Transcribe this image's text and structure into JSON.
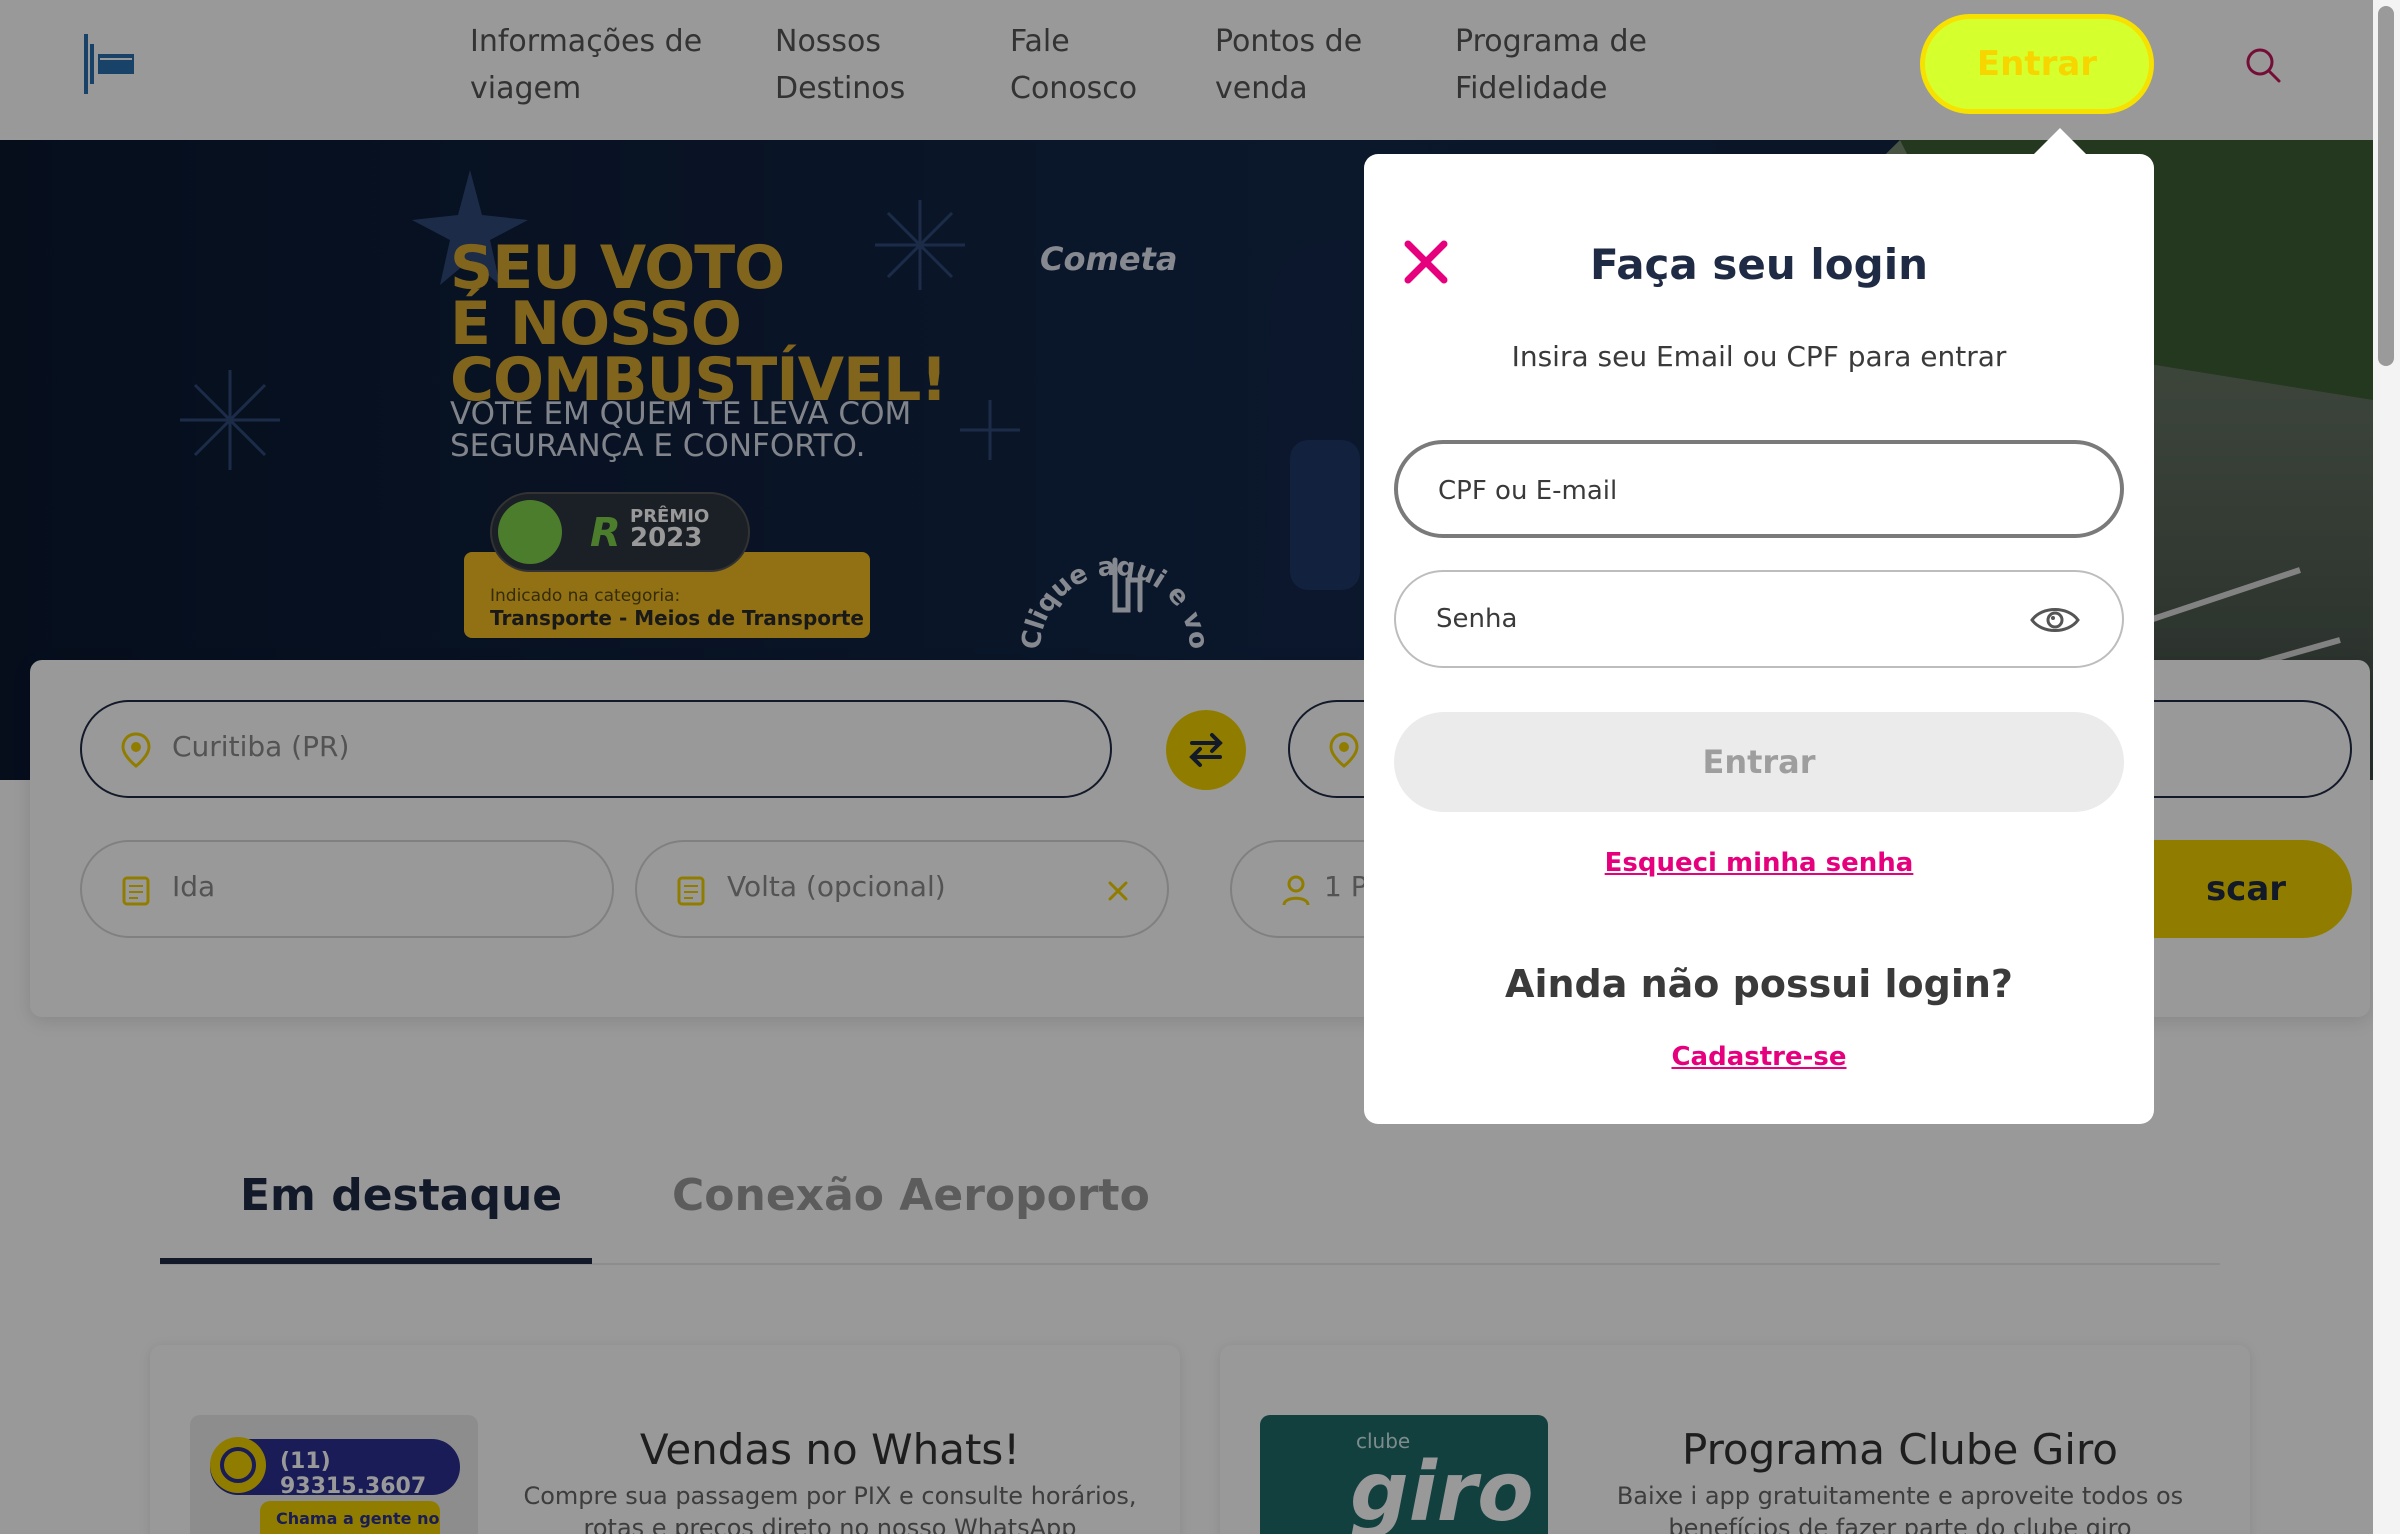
{
  "header": {
    "logo_alt": "Cometa logo",
    "nav": [
      {
        "line1": "Informações de",
        "line2": "viagem"
      },
      {
        "line1": "Nossos",
        "line2": "Destinos"
      },
      {
        "line1": "Fale",
        "line2": "Conosco"
      },
      {
        "line1": "Pontos de",
        "line2": "venda"
      },
      {
        "line1": "Programa de",
        "line2": "Fidelidade"
      }
    ],
    "login_button": "Entrar",
    "search_icon": "search-icon"
  },
  "banner": {
    "headline": [
      "SEU VOTO",
      "É NOSSO",
      "COMBUSTÍVEL!"
    ],
    "subline": [
      "VOTE EM QUEM TE LEVA COM",
      "SEGURANÇA E CONFORTO."
    ],
    "brand": "Cometa",
    "award": {
      "badge_letter": "R",
      "label_top": "PRÊMIO",
      "label_year": "2023",
      "category_intro": "Indicado na categoria:",
      "category": "Transporte - Meios de Transporte"
    },
    "cta_curved": "Clique aqui e vote"
  },
  "search": {
    "origin_value": "Curitiba (PR)",
    "dest_value": "",
    "ida_placeholder": "Ida",
    "volta_placeholder": "Volta (opcional)",
    "passengers_partial": "1 P",
    "buscar_partial": "scar"
  },
  "tabs": [
    {
      "label": "Em destaque",
      "active": true
    },
    {
      "label": "Conexão Aeroporto",
      "active": false
    }
  ],
  "promos": [
    {
      "title": "Vendas no Whats!",
      "desc_line1": "Compre sua passagem por PIX e consulte horários,",
      "desc_line2": "rotas e preços direto no nosso WhatsApp",
      "image_phone": "(11) 93315.3607",
      "image_caption": "Chama a gente no"
    },
    {
      "title": "Programa Clube Giro",
      "desc_line1": "Baixe i app gratuitamente e aproveite todos os",
      "desc_line2": "benefícios de fazer parte do clube giro",
      "image_label_small": "clube",
      "image_label_big": "giro"
    }
  ],
  "login_modal": {
    "title": "Faça seu login",
    "subtitle": "Insira seu Email ou CPF para entrar",
    "user_placeholder": "CPF ou E-mail",
    "password_placeholder": "Senha",
    "submit": "Entrar",
    "forgot": "Esqueci minha senha",
    "no_login": "Ainda não possui login?",
    "register": "Cadastre-se"
  },
  "colors": {
    "brand_yellow": "#f1d100",
    "login_green": "#d6ff2e",
    "link_magenta": "#e6007e",
    "navy": "#1f2a44"
  }
}
